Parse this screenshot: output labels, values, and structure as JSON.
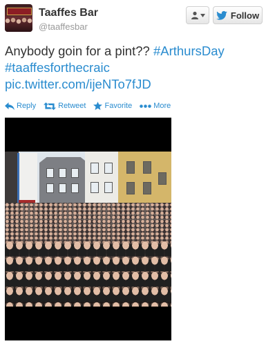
{
  "user": {
    "display_name": "Taaffes Bar",
    "screen_name": "@taaffesbar"
  },
  "buttons": {
    "follow_label": "Follow",
    "user_menu_icon": "person-icon"
  },
  "tweet": {
    "text_plain": "Anybody goin for a pint?? ",
    "hashtag1": "#ArthursDay",
    "hashtag2": "#taaffesforthecraic",
    "pic_link": "pic.twitter.com/ijeNTo7fJD"
  },
  "actions": {
    "reply": "Reply",
    "retweet": "Retweet",
    "favorite": "Favorite",
    "more": "More"
  },
  "colors": {
    "link": "#2a8ccf",
    "text": "#333333",
    "muted": "#999999"
  }
}
